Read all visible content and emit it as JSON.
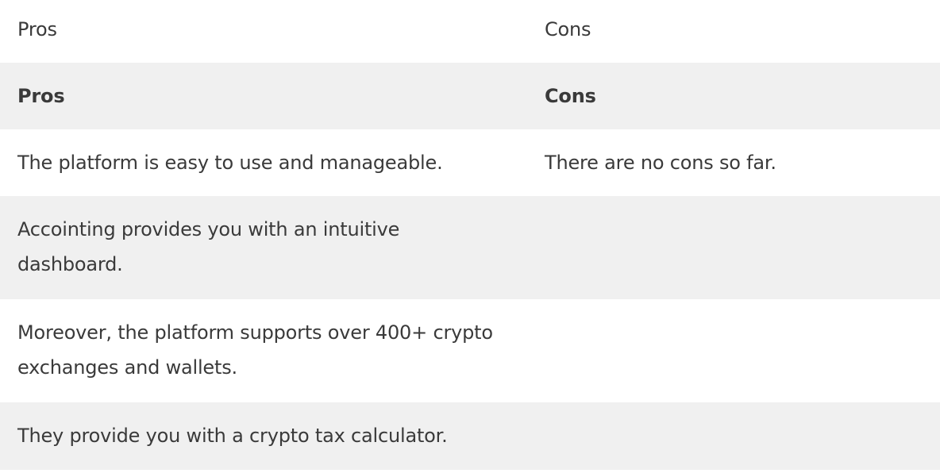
{
  "table": {
    "header": {
      "pros": "Pros",
      "cons": "Cons"
    },
    "subheader": {
      "pros": "Pros",
      "cons": "Cons"
    },
    "rows": [
      {
        "pros": "The platform is easy to use and manageable.",
        "cons": "There are no cons so far."
      },
      {
        "pros": "Accointing provides you with an intuitive dashboard.",
        "cons": ""
      },
      {
        "pros": "Moreover, the platform supports over 400+ crypto exchanges and wallets.",
        "cons": ""
      },
      {
        "pros": "They provide you with a crypto tax calculator.",
        "cons": ""
      }
    ]
  }
}
